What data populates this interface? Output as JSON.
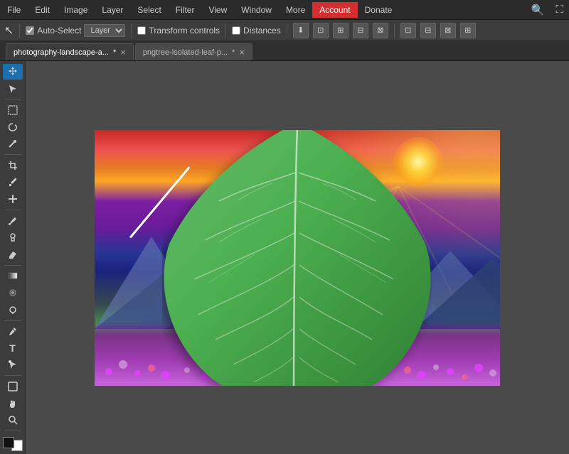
{
  "menu": {
    "items": [
      {
        "label": "File",
        "key": "file"
      },
      {
        "label": "Edit",
        "key": "edit"
      },
      {
        "label": "Image",
        "key": "image"
      },
      {
        "label": "Layer",
        "key": "layer"
      },
      {
        "label": "Select",
        "key": "select"
      },
      {
        "label": "Filter",
        "key": "filter"
      },
      {
        "label": "View",
        "key": "view"
      },
      {
        "label": "Window",
        "key": "window"
      },
      {
        "label": "More",
        "key": "more"
      },
      {
        "label": "Account",
        "key": "account",
        "active": true
      },
      {
        "label": "Donate",
        "key": "donate"
      }
    ]
  },
  "toolbar": {
    "autoselect_label": "Auto-Select",
    "layer_label": "Layer",
    "transform_controls_label": "Transform controls",
    "distances_label": "Distances"
  },
  "tabs": [
    {
      "label": "photography-landscape-a...",
      "active": true,
      "modified": true
    },
    {
      "label": "pngtree-isolated-leaf-p...",
      "active": false,
      "modified": true
    }
  ],
  "tools": [
    {
      "name": "move",
      "icon": "✛",
      "active": true
    },
    {
      "name": "cursor",
      "icon": "↖"
    },
    {
      "name": "marquee-rect",
      "icon": "⬚"
    },
    {
      "name": "lasso",
      "icon": "⌒"
    },
    {
      "name": "magic-wand",
      "icon": "✲"
    },
    {
      "name": "crop",
      "icon": "⌗"
    },
    {
      "name": "eyedropper",
      "icon": "🖉"
    },
    {
      "name": "healing",
      "icon": "✚"
    },
    {
      "name": "brush",
      "icon": "✏"
    },
    {
      "name": "stamp",
      "icon": "⊕"
    },
    {
      "name": "eraser",
      "icon": "◻"
    },
    {
      "name": "gradient",
      "icon": "▣"
    },
    {
      "name": "blur",
      "icon": "◎"
    },
    {
      "name": "dodge",
      "icon": "⬡"
    },
    {
      "name": "pen",
      "icon": "✒"
    },
    {
      "name": "text",
      "icon": "T"
    },
    {
      "name": "path-select",
      "icon": "♦"
    },
    {
      "name": "shape",
      "icon": "△"
    },
    {
      "name": "hand",
      "icon": "✋"
    },
    {
      "name": "zoom",
      "icon": "⊕"
    }
  ],
  "colors": {
    "fg": "#000000",
    "bg": "#ffffff",
    "accent": "#d32f2f",
    "toolbar_bg": "#3c3c3c",
    "menubar_bg": "#2b2b2b",
    "canvas_bg": "#4a4a4a"
  }
}
